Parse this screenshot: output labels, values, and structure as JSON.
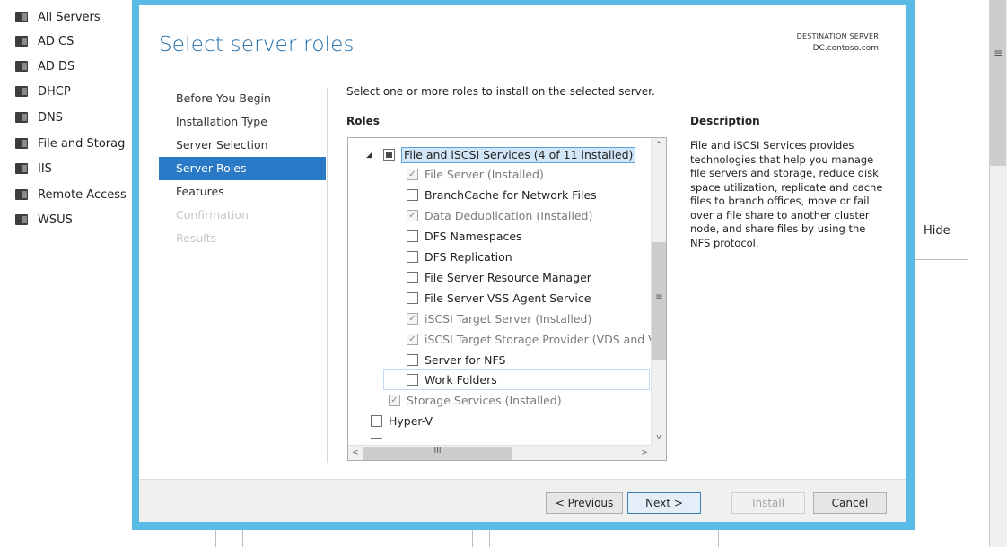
{
  "background": {
    "servers": [
      {
        "label": "All Servers",
        "icon": "all-servers-icon"
      },
      {
        "label": "AD CS",
        "icon": "ad-cs-icon"
      },
      {
        "label": "AD DS",
        "icon": "ad-ds-icon"
      },
      {
        "label": "DHCP",
        "icon": "dhcp-icon"
      },
      {
        "label": "DNS",
        "icon": "dns-icon"
      },
      {
        "label": "File and Storag",
        "icon": "file-storage-icon"
      },
      {
        "label": "IIS",
        "icon": "iis-icon"
      },
      {
        "label": "Remote Access",
        "icon": "remote-access-icon"
      },
      {
        "label": "WSUS",
        "icon": "wsus-icon"
      }
    ],
    "hide_label": "Hide",
    "scroll_grip": "≡"
  },
  "wizard": {
    "title": "Select server roles",
    "destination_label": "DESTINATION SERVER",
    "destination_server": "DC.contoso.com",
    "nav": [
      {
        "label": "Before You Begin",
        "state": "normal"
      },
      {
        "label": "Installation Type",
        "state": "normal"
      },
      {
        "label": "Server Selection",
        "state": "normal"
      },
      {
        "label": "Server Roles",
        "state": "active"
      },
      {
        "label": "Features",
        "state": "normal"
      },
      {
        "label": "Confirmation",
        "state": "disabled"
      },
      {
        "label": "Results",
        "state": "disabled"
      }
    ],
    "instruction": "Select one or more roles to install on the selected server.",
    "roles_heading": "Roles",
    "description_heading": "Description",
    "description": "File and iSCSI Services provides technologies that help you manage file servers and storage, reduce disk space utilization, replicate and cache files to branch offices, move or fail over a file share to another cluster node, and share files by using the NFS protocol.",
    "roles": {
      "parent": {
        "expander": "◢",
        "label": "File and iSCSI Services (4 of 11 installed)"
      },
      "children": [
        {
          "label": "File Server (Installed)",
          "checked": true,
          "disabled": true
        },
        {
          "label": "BranchCache for Network Files",
          "checked": false,
          "disabled": false
        },
        {
          "label": "Data Deduplication (Installed)",
          "checked": true,
          "disabled": true
        },
        {
          "label": "DFS Namespaces",
          "checked": false,
          "disabled": false
        },
        {
          "label": "DFS Replication",
          "checked": false,
          "disabled": false
        },
        {
          "label": "File Server Resource Manager",
          "checked": false,
          "disabled": false
        },
        {
          "label": "File Server VSS Agent Service",
          "checked": false,
          "disabled": false
        },
        {
          "label": "iSCSI Target Server (Installed)",
          "checked": true,
          "disabled": true
        },
        {
          "label": "iSCSI Target Storage Provider (VDS and VSS",
          "checked": true,
          "disabled": true
        },
        {
          "label": "Server for NFS",
          "checked": false,
          "disabled": false
        },
        {
          "label": "Work Folders",
          "checked": false,
          "disabled": false
        }
      ],
      "storage_services": {
        "label": "Storage Services (Installed)",
        "checked": true,
        "disabled": true
      },
      "hyper_v": {
        "label": "Hyper-V",
        "checked": false,
        "disabled": false
      },
      "scroll_up": "^",
      "scroll_down": "v",
      "scroll_left": "<",
      "scroll_right": ">",
      "v_grip": "≡",
      "h_grip": "III"
    },
    "buttons": {
      "previous": "< Previous",
      "next": "Next >",
      "install": "Install",
      "cancel": "Cancel"
    },
    "check_mark": "✓"
  }
}
